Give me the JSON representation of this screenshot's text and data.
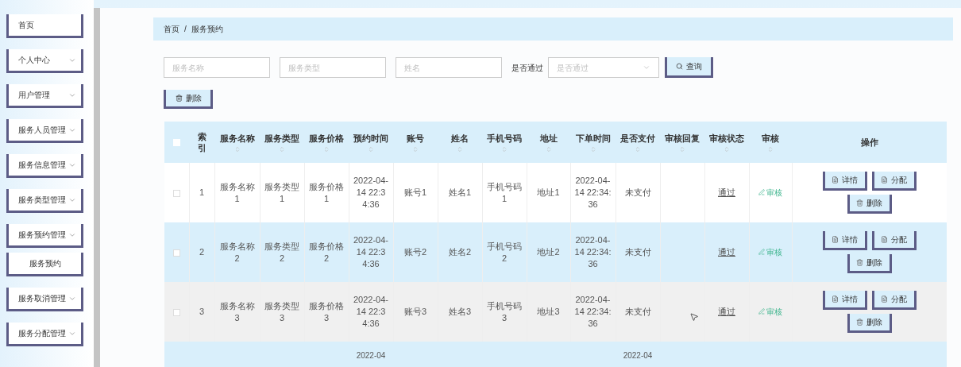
{
  "sidebar": {
    "items": [
      {
        "label": "首页",
        "kind": "link"
      },
      {
        "label": "个人中心",
        "kind": "group"
      },
      {
        "label": "用户管理",
        "kind": "group"
      },
      {
        "label": "服务人员管理",
        "kind": "group"
      },
      {
        "label": "服务信息管理",
        "kind": "group"
      },
      {
        "label": "服务类型管理",
        "kind": "group"
      },
      {
        "label": "服务预约管理",
        "kind": "group"
      },
      {
        "label": "服务预约",
        "kind": "submenu"
      },
      {
        "label": "服务取消管理",
        "kind": "group"
      },
      {
        "label": "服务分配管理",
        "kind": "group"
      }
    ]
  },
  "breadcrumb": [
    "首页",
    "/",
    "服务预约"
  ],
  "search": {
    "fields": [
      {
        "placeholder": "服务名称"
      },
      {
        "placeholder": "服务类型"
      },
      {
        "placeholder": "姓名"
      }
    ],
    "select_label": "是否通过",
    "select": {
      "placeholder": "是否通过"
    },
    "query_button": "查询"
  },
  "delete_button": "删除",
  "table": {
    "all_checked": false,
    "columns": [
      {
        "label": "索引",
        "kind": "plain"
      },
      {
        "label": "服务名称",
        "kind": "sort"
      },
      {
        "label": "服务类型",
        "kind": "sort"
      },
      {
        "label": "服务价格",
        "kind": "sort"
      },
      {
        "label": "预约时间",
        "kind": "sort"
      },
      {
        "label": "账号",
        "kind": "sort"
      },
      {
        "label": "姓名",
        "kind": "sort"
      },
      {
        "label": "手机号码",
        "kind": "sort"
      },
      {
        "label": "地址",
        "kind": "sort"
      },
      {
        "label": "下单时间",
        "kind": "sort"
      },
      {
        "label": "是否支付",
        "kind": "sort"
      },
      {
        "label": "审核回复",
        "kind": "sort"
      },
      {
        "label": "审核状态",
        "kind": "sort"
      },
      {
        "label": "审核",
        "kind": "sort"
      },
      {
        "label": "操作",
        "kind": "plain"
      }
    ],
    "rows": [
      {
        "checked": false,
        "hovered": false,
        "cells": [
          "1",
          "服务名称1",
          "服务类型1",
          "服务价格1",
          "2022-04-14 22:34:36",
          "账号1",
          "姓名1",
          "手机号码1",
          "地址1",
          "2022-04-14 22:34:36",
          "未支付",
          "",
          "通过"
        ],
        "review": "审核",
        "actions": [
          "详情",
          "分配",
          "删除"
        ]
      },
      {
        "checked": false,
        "hovered": false,
        "cells": [
          "2",
          "服务名称2",
          "服务类型2",
          "服务价格2",
          "2022-04-14 22:34:36",
          "账号2",
          "姓名2",
          "手机号码2",
          "地址2",
          "2022-04-14 22:34:36",
          "未支付",
          "",
          "通过"
        ],
        "review": "审核",
        "actions": [
          "详情",
          "分配",
          "删除"
        ]
      },
      {
        "checked": false,
        "hovered": true,
        "cells": [
          "3",
          "服务名称3",
          "服务类型3",
          "服务价格3",
          "2022-04-14 22:34:36",
          "账号3",
          "姓名3",
          "手机号码3",
          "地址3",
          "2022-04-14 22:34:36",
          "未支付",
          "",
          "通过"
        ],
        "review": "审核",
        "actions": [
          "详情",
          "分配",
          "删除"
        ]
      }
    ],
    "partial_row": {
      "cells": [
        "2022-04",
        "2022-04"
      ]
    }
  }
}
